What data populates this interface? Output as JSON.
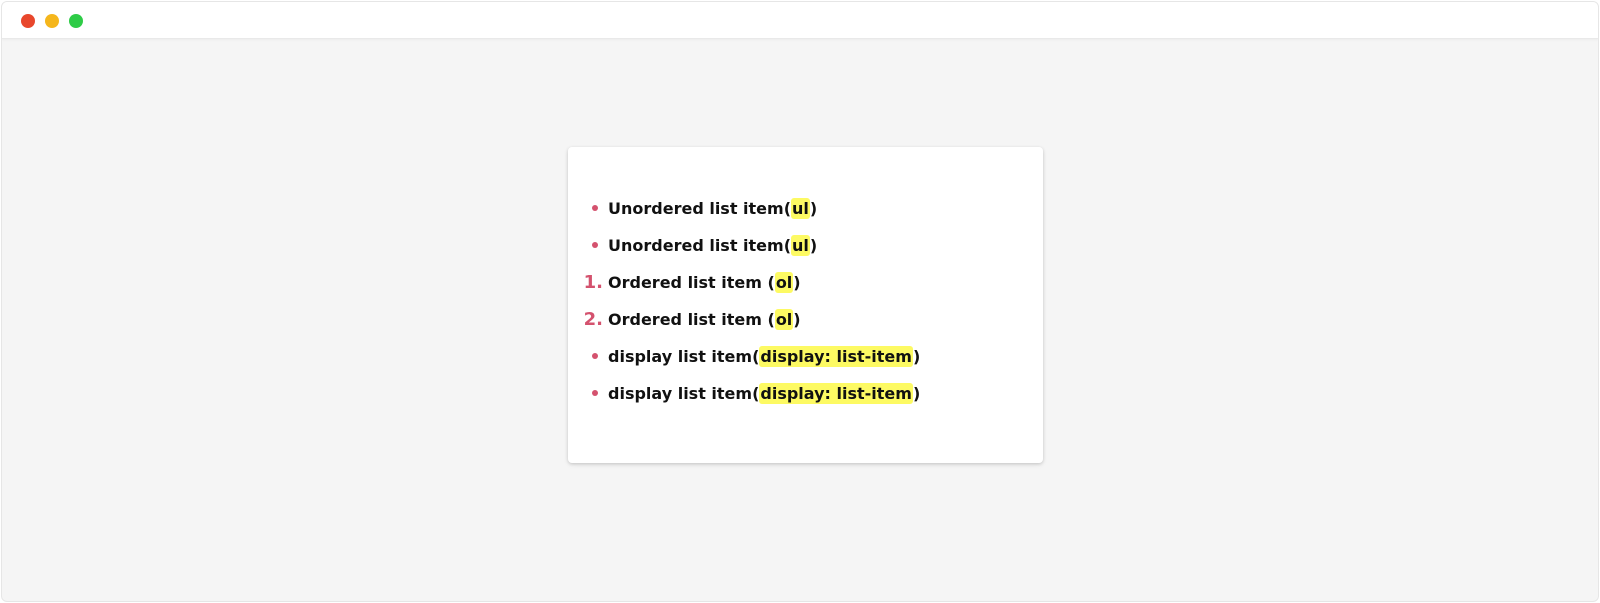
{
  "colors": {
    "close": "#e8472c",
    "minimize": "#f5b61c",
    "maximize": "#2ecc47",
    "marker": "#d4526e",
    "highlight": "#fdfa63"
  },
  "list": {
    "items": [
      {
        "type": "bullet",
        "marker": "",
        "text": "Unordered list item",
        "open": "(",
        "code": "ul",
        "close": ")"
      },
      {
        "type": "bullet",
        "marker": "",
        "text": "Unordered list item",
        "open": "(",
        "code": "ul",
        "close": ")"
      },
      {
        "type": "number",
        "marker": "1.",
        "text": "Ordered list item ",
        "open": "(",
        "code": "ol",
        "close": ")"
      },
      {
        "type": "number",
        "marker": "2.",
        "text": "Ordered list item ",
        "open": "(",
        "code": "ol",
        "close": ")"
      },
      {
        "type": "bullet",
        "marker": "",
        "text": "display list item",
        "open": "(",
        "code": "display: list-item",
        "close": ")"
      },
      {
        "type": "bullet",
        "marker": "",
        "text": "display list item",
        "open": "(",
        "code": "display: list-item",
        "close": ")"
      }
    ]
  }
}
